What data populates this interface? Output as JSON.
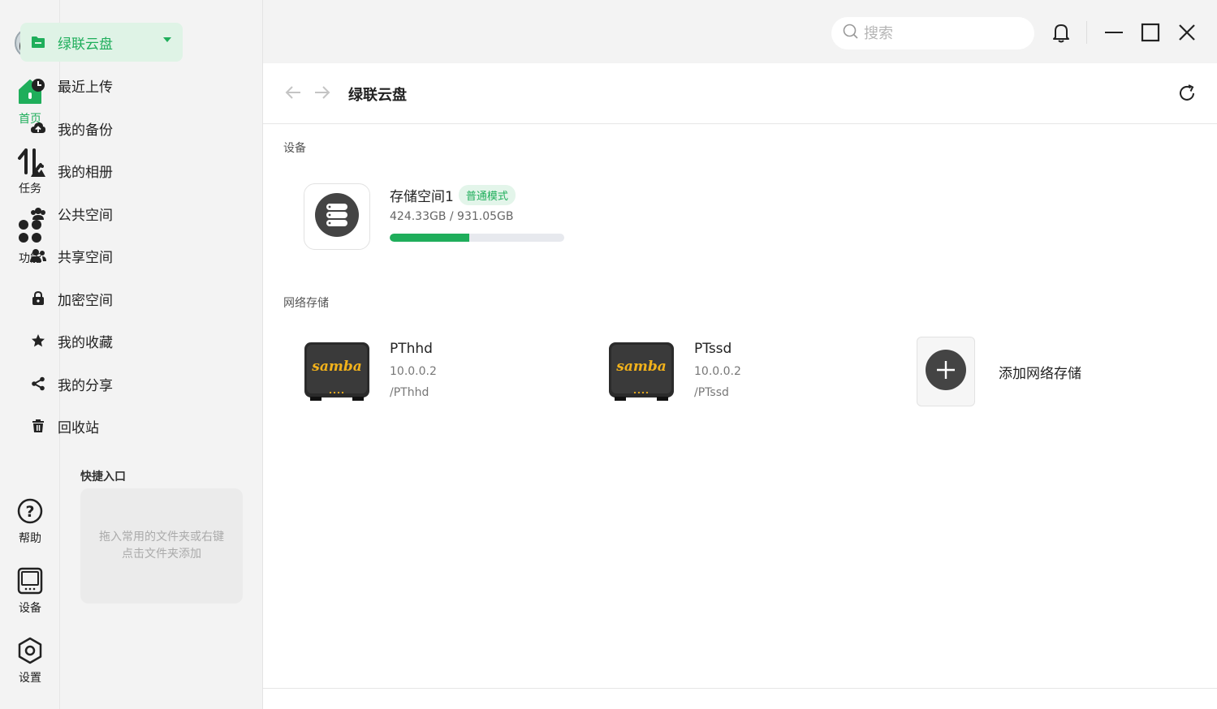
{
  "rail": {
    "items": [
      {
        "label": "首页",
        "icon": "home-icon"
      },
      {
        "label": "任务",
        "icon": "transfer-icon"
      },
      {
        "label": "功能",
        "icon": "apps-icon"
      },
      {
        "label": "帮助",
        "icon": "help-icon"
      },
      {
        "label": "设备",
        "icon": "device-icon"
      },
      {
        "label": "设置",
        "icon": "settings-icon"
      }
    ]
  },
  "nav": {
    "items": [
      {
        "label": "绿联云盘",
        "icon": "folder-icon"
      },
      {
        "label": "最近上传",
        "icon": "clock-icon"
      },
      {
        "label": "我的备份",
        "icon": "cloud-upload-icon"
      },
      {
        "label": "我的相册",
        "icon": "photo-icon"
      },
      {
        "label": "公共空间",
        "icon": "group-icon"
      },
      {
        "label": "共享空间",
        "icon": "users-icon"
      },
      {
        "label": "加密空间",
        "icon": "lock-icon"
      },
      {
        "label": "我的收藏",
        "icon": "star-icon"
      },
      {
        "label": "我的分享",
        "icon": "share-icon"
      },
      {
        "label": "回收站",
        "icon": "trash-icon"
      }
    ],
    "quick_title": "快捷入口",
    "quick_hint": "拖入常用的文件夹或右键点击文件夹添加"
  },
  "topbar": {
    "search_placeholder": "搜索"
  },
  "breadcrumb": {
    "title": "绿联云盘"
  },
  "devices": {
    "label": "设备",
    "storage": {
      "name": "存储空间1",
      "mode": "普通模式",
      "usage": "424.33GB / 931.05GB",
      "used_fraction": 0.456
    }
  },
  "network": {
    "label": "网络存储",
    "items": [
      {
        "name": "PThhd",
        "ip": "10.0.0.2",
        "path": "/PThhd",
        "logo_text": "samba"
      },
      {
        "name": "PTssd",
        "ip": "10.0.0.2",
        "path": "/PTssd",
        "logo_text": "samba"
      }
    ],
    "add_label": "添加网络存储"
  },
  "colors": {
    "accent": "#1fae5b",
    "accent_bg": "#dff3e6",
    "sidebar_bg": "#f3f3f3"
  }
}
